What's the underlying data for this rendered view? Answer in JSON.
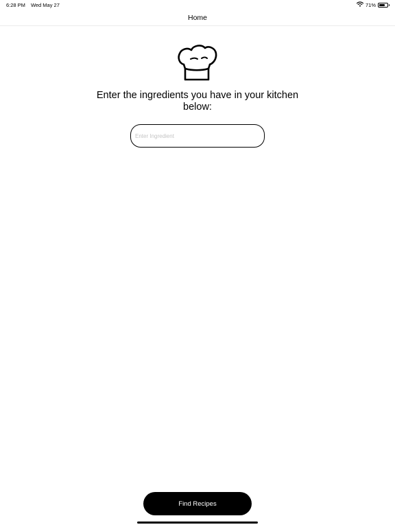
{
  "status_bar": {
    "time": "6:28 PM",
    "date": "Wed May 27",
    "battery_text": "71%",
    "battery_level": 0.71
  },
  "nav": {
    "title": "Home"
  },
  "main": {
    "icon": "chef-hat-icon",
    "prompt": "Enter the ingredients you have in your kitchen below:",
    "ingredient_input": {
      "value": "",
      "placeholder": "Enter Ingredient"
    }
  },
  "footer": {
    "find_label": "Find Recipes"
  },
  "colors": {
    "primary": "#000000",
    "background": "#ffffff",
    "placeholder": "#c4c4c4"
  }
}
